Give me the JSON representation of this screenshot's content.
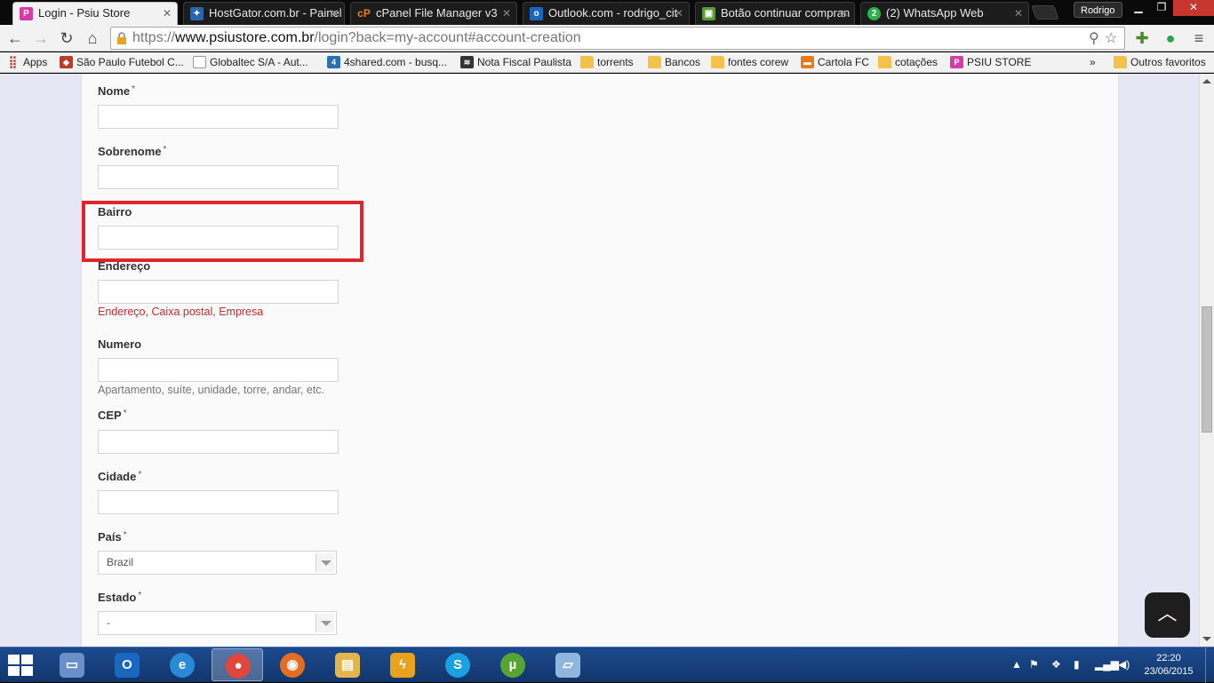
{
  "browser": {
    "tabs": [
      {
        "title": "Login - Psiu Store",
        "icon": "psiu-store-favicon",
        "active": true
      },
      {
        "title": "HostGator.com.br - Painel",
        "icon": "hostgator-favicon",
        "active": false
      },
      {
        "title": "cPanel File Manager v3",
        "icon": "cpanel-favicon",
        "active": false
      },
      {
        "title": "Outlook.com - rodrigo_cit",
        "icon": "outlook-favicon",
        "active": false
      },
      {
        "title": "Botão continuar compran",
        "icon": "extension-favicon",
        "active": false
      },
      {
        "title": "(2) WhatsApp Web",
        "icon": "whatsapp-favicon",
        "active": false
      }
    ],
    "profile_name": "Rodrigo",
    "url": {
      "scheme": "https://",
      "host": "www.psiustore.com.br",
      "path": "/login?back=my-account#account-creation"
    },
    "bookmarks": [
      {
        "label": "Apps",
        "icon": "apps-grid-icon"
      },
      {
        "label": "São Paulo Futebol C...",
        "icon": "spfc-icon"
      },
      {
        "label": "Globaltec S/A - Aut...",
        "icon": "page-icon"
      },
      {
        "label": "4shared.com - busq...",
        "icon": "4shared-icon"
      },
      {
        "label": "Nota Fiscal Paulista",
        "icon": "nfp-icon"
      },
      {
        "label": "torrents",
        "icon": "folder-icon"
      },
      {
        "label": "Bancos",
        "icon": "folder-icon"
      },
      {
        "label": "fontes corew",
        "icon": "folder-icon"
      },
      {
        "label": "Cartola FC",
        "icon": "cartola-icon"
      },
      {
        "label": "cotações",
        "icon": "folder-icon"
      },
      {
        "label": "PSIU STORE",
        "icon": "psiu-store-icon"
      }
    ],
    "bookmarks_overflow": "»",
    "other_bookmarks": "Outros favoritos"
  },
  "form": {
    "required_mark": "*",
    "nome": {
      "label": "Nome",
      "value": ""
    },
    "sobrenome": {
      "label": "Sobrenome",
      "value": ""
    },
    "bairro": {
      "label": "Bairro",
      "value": ""
    },
    "endereco": {
      "label": "Endereço",
      "value": "",
      "hint": "Endereço, Caixa postal, Empresa"
    },
    "numero": {
      "label": "Numero",
      "value": "",
      "hint": "Apartamento, suíte, unidade, torre, andar, etc."
    },
    "cep": {
      "label": "CEP",
      "value": ""
    },
    "cidade": {
      "label": "Cidade",
      "value": ""
    },
    "pais": {
      "label": "País",
      "selected": "Brazil"
    },
    "estado": {
      "label": "Estado",
      "selected": "-"
    }
  },
  "taskbar": {
    "apps": [
      {
        "name": "computer",
        "color": "#6b8fc7",
        "active": false
      },
      {
        "name": "outlook",
        "color": "#1a67c2",
        "active": false
      },
      {
        "name": "internet-explorer",
        "color": "#2b8ad8",
        "active": false
      },
      {
        "name": "chrome",
        "color": "#e0463a",
        "active": true
      },
      {
        "name": "firefox",
        "color": "#e66d1f",
        "active": false
      },
      {
        "name": "file-explorer",
        "color": "#e4b54a",
        "active": false
      },
      {
        "name": "winamp",
        "color": "#e8a21c",
        "active": false
      },
      {
        "name": "skype",
        "color": "#1ba1e2",
        "active": false
      },
      {
        "name": "utorrent",
        "color": "#56a434",
        "active": false
      },
      {
        "name": "notepad",
        "color": "#8fb6dc",
        "active": false
      }
    ],
    "time": "22:20",
    "date": "23/06/2015"
  },
  "colors": {
    "highlight_box": "#e1252c",
    "hint_red": "#d0282e",
    "page_bg": "#e6e6f5"
  }
}
